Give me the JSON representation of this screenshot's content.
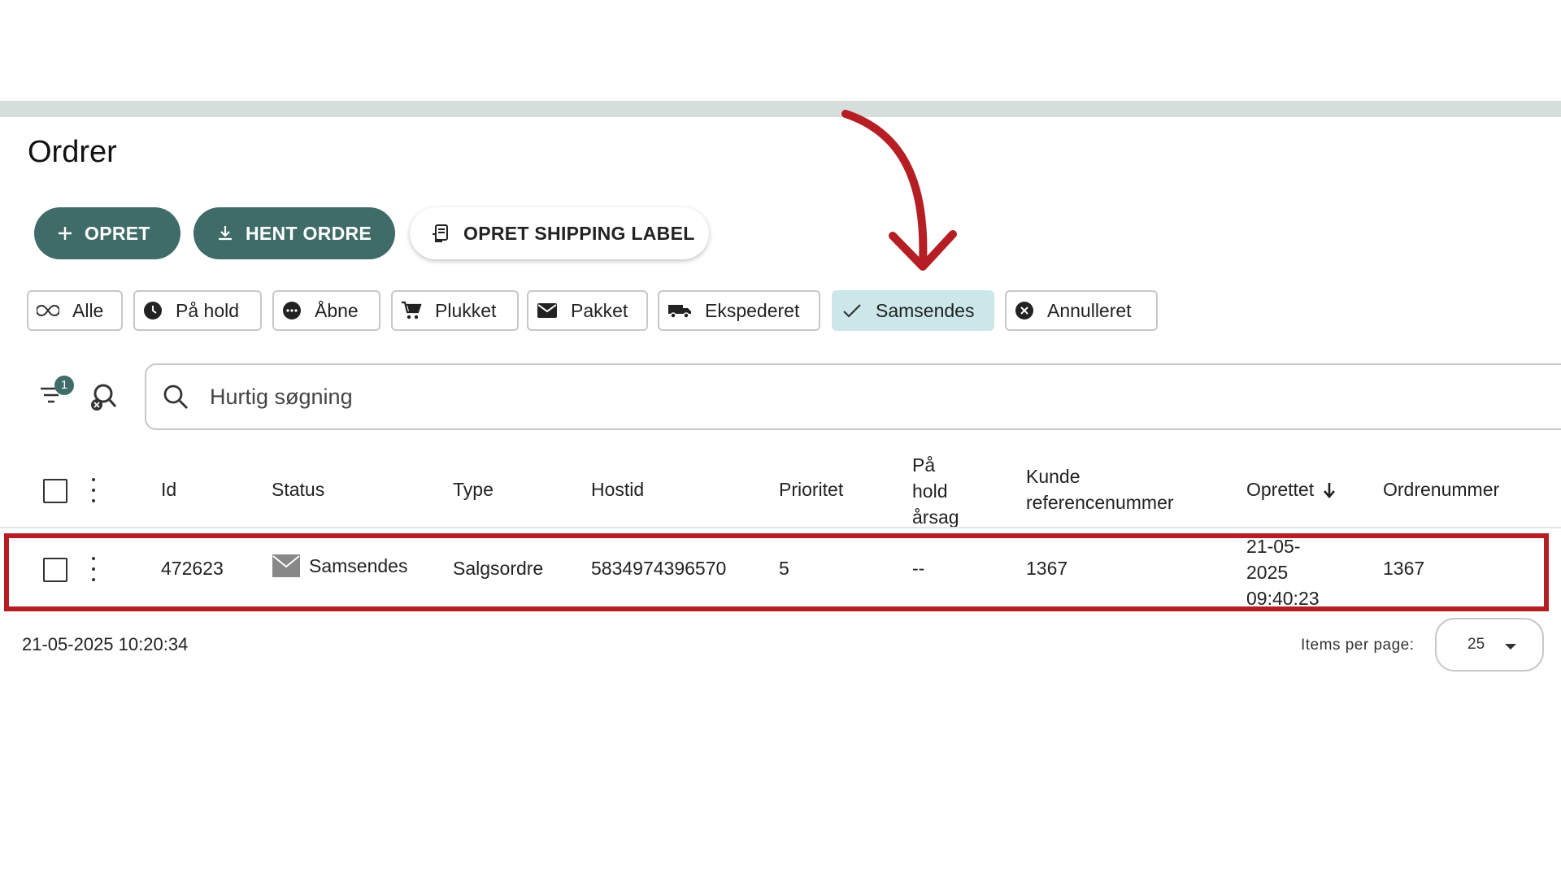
{
  "page": {
    "title": "Ordrer"
  },
  "toolbar": {
    "create_label": "OPRET",
    "fetch_label": "HENT ORDRE",
    "shipping_label": "OPRET SHIPPING LABEL"
  },
  "filters": {
    "active": "Samsendes",
    "chips": [
      {
        "label": "Alle",
        "icon": "infinity-icon"
      },
      {
        "label": "På hold",
        "icon": "clock-icon"
      },
      {
        "label": "Åbne",
        "icon": "more-circle-icon"
      },
      {
        "label": "Plukket",
        "icon": "cart-icon"
      },
      {
        "label": "Pakket",
        "icon": "envelope-icon"
      },
      {
        "label": "Ekspederet",
        "icon": "truck-icon"
      },
      {
        "label": "Samsendes",
        "icon": "check-icon"
      },
      {
        "label": "Annulleret",
        "icon": "cancel-circle-icon"
      }
    ]
  },
  "search": {
    "filter_count": "1",
    "placeholder": "Hurtig søgning"
  },
  "table": {
    "columns": {
      "id": "Id",
      "status": "Status",
      "type": "Type",
      "hostid": "Hostid",
      "priority": "Prioritet",
      "hold_reason_1": "På",
      "hold_reason_2": "hold",
      "hold_reason_3": "årsag",
      "customer_ref_1": "Kunde",
      "customer_ref_2": "referencenummer",
      "created": "Oprettet",
      "order_number": "Ordrenummer"
    },
    "rows": [
      {
        "id": "472623",
        "status": "Samsendes",
        "type": "Salgsordre",
        "hostid": "5834974396570",
        "priority": "5",
        "hold_reason": "--",
        "customer_ref": "1367",
        "created_1": "21-05-",
        "created_2": "2025",
        "created_3": "09:40:23",
        "order_number": "1367"
      }
    ]
  },
  "footer": {
    "timestamp": "21-05-2025 10:20:34",
    "items_per_page_label": "Items per page:",
    "items_per_page_value": "25"
  },
  "colors": {
    "primary": "#3f6b68",
    "active_chip": "#cce7ea",
    "highlight": "#b51f24"
  }
}
